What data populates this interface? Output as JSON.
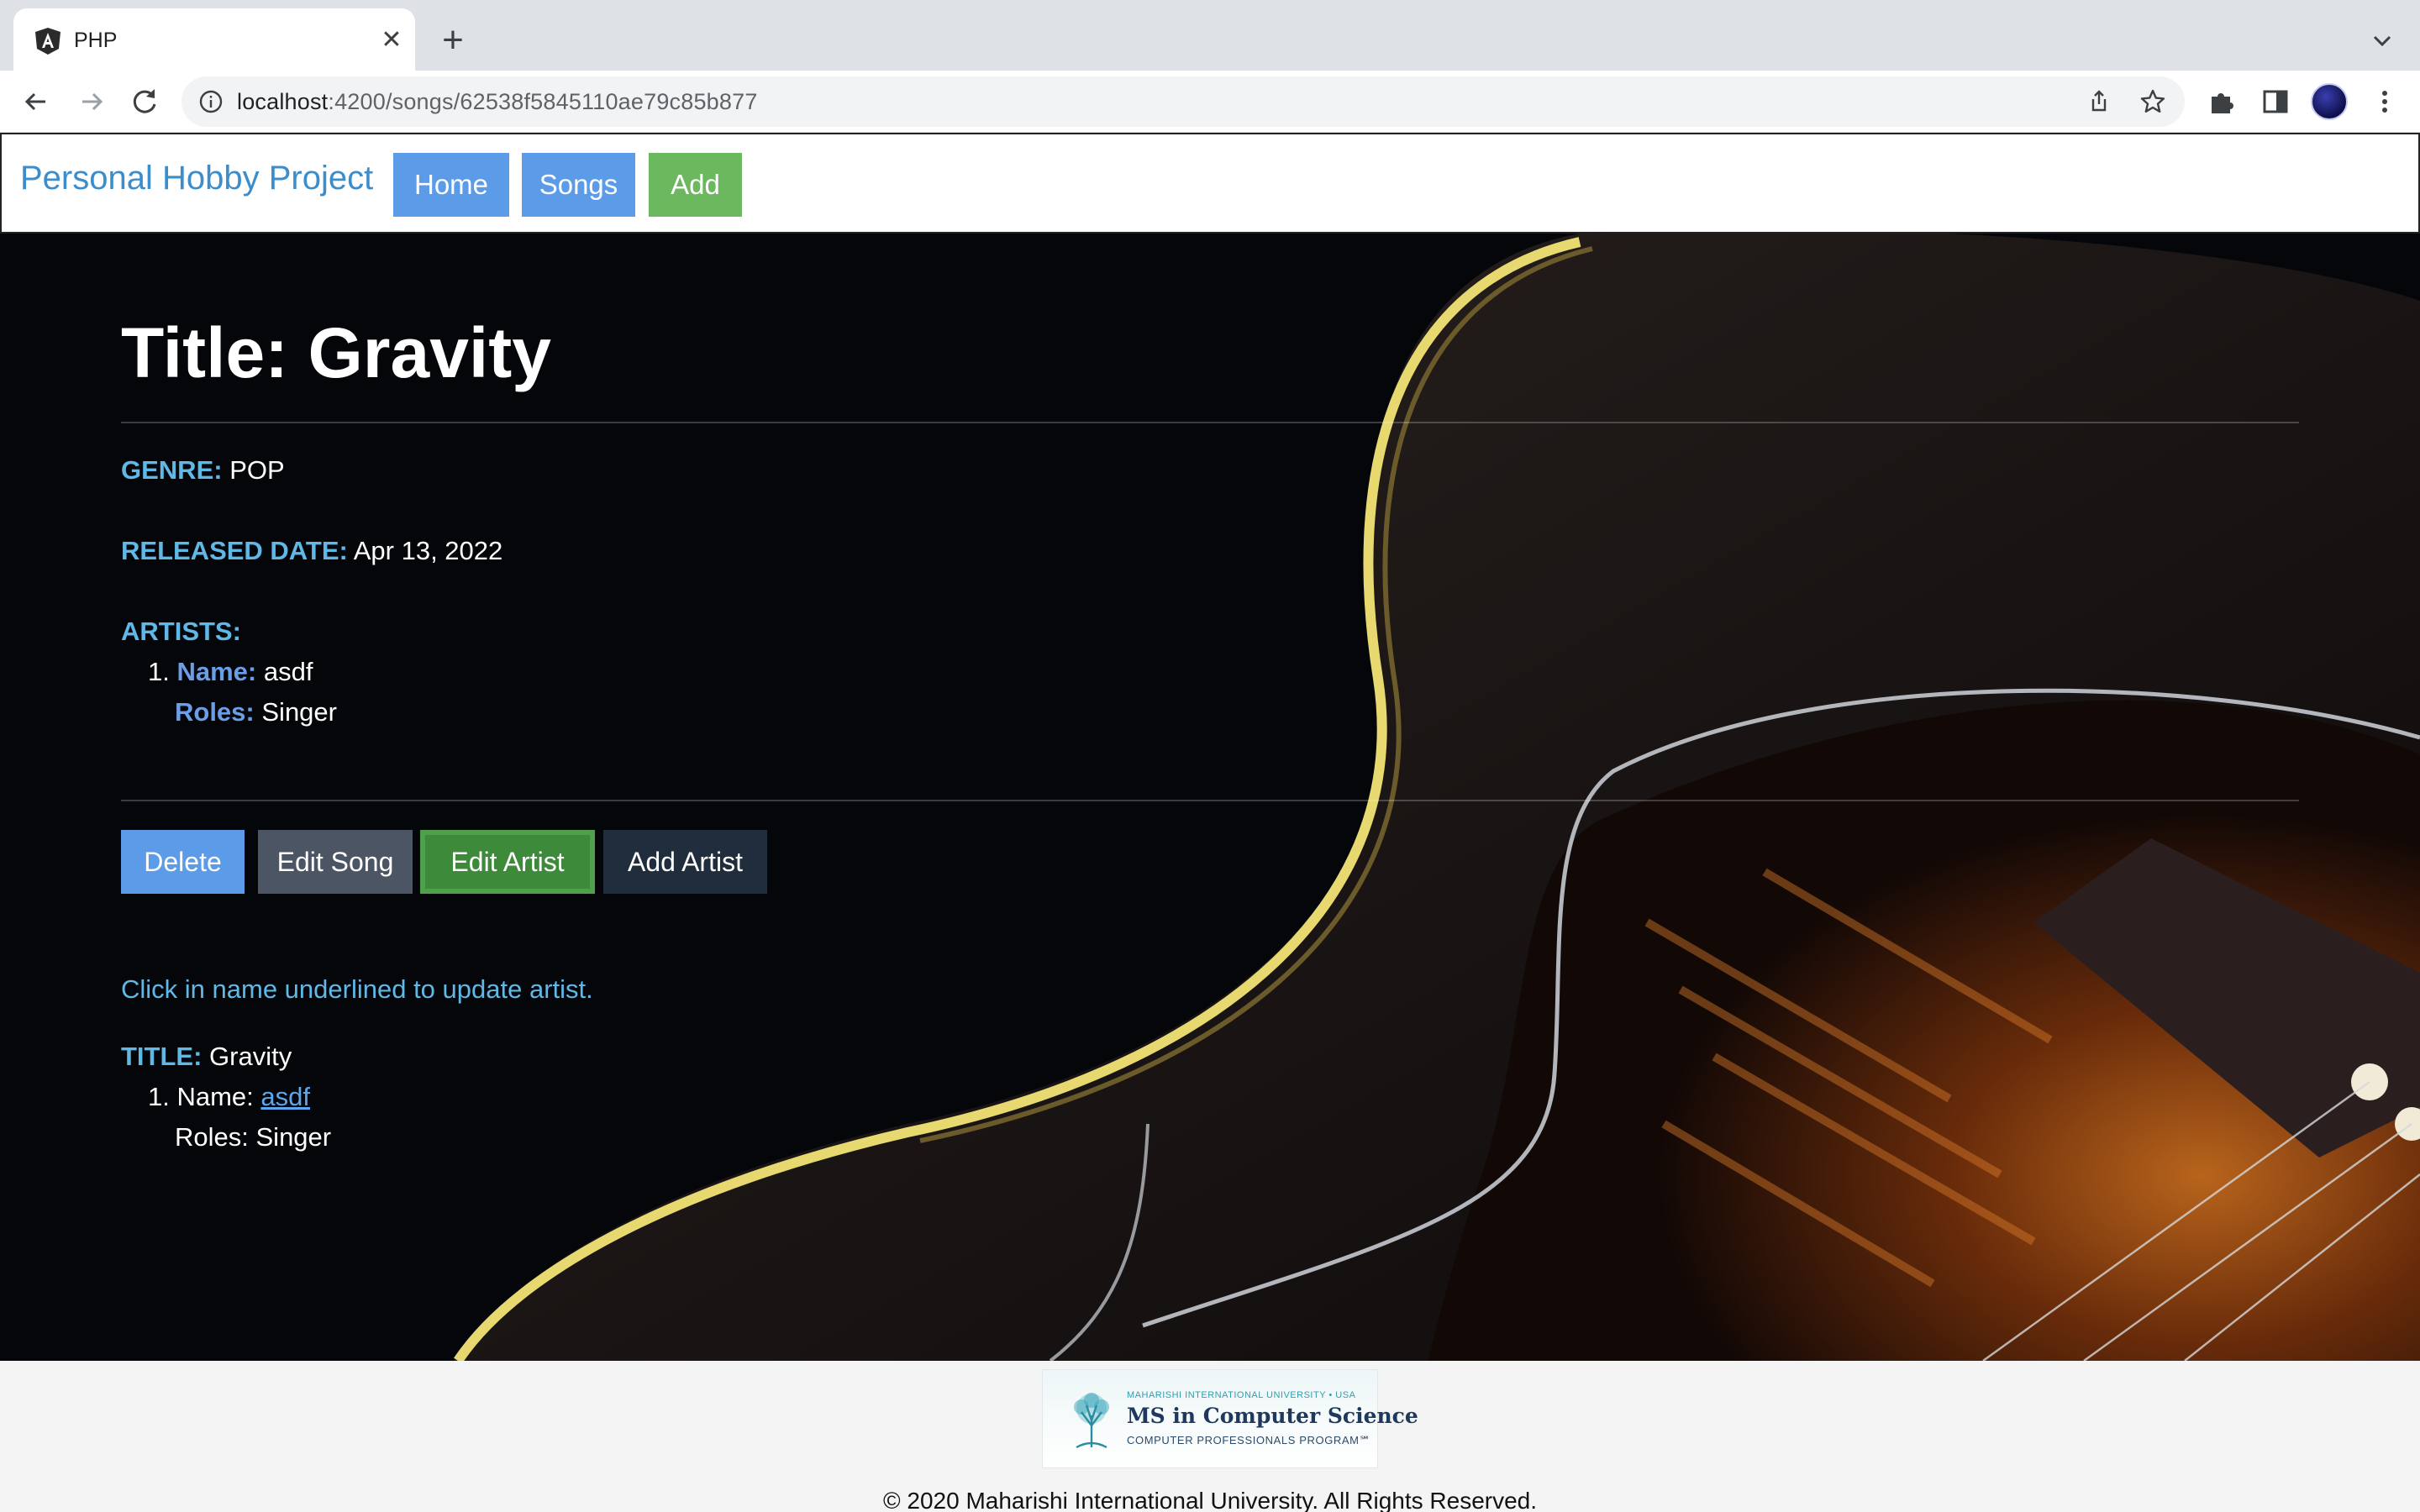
{
  "browser": {
    "tab_title": "PHP",
    "url_host": "localhost",
    "url_path": ":4200/songs/62538f5845110ae79c85b877"
  },
  "navbar": {
    "brand": "Personal Hobby Project",
    "links": [
      {
        "label": "Home",
        "color": "#5b9be8"
      },
      {
        "label": "Songs",
        "color": "#5b9be8"
      },
      {
        "label": "Add",
        "color": "#6bb85f"
      }
    ]
  },
  "song": {
    "title_label": "Title: Gravity",
    "genre_label": "GENRE:",
    "genre": "POP",
    "released_label": "RELEASED DATE:",
    "released": "Apr 13, 2022",
    "artists_label": "ARTISTS:",
    "artists": [
      {
        "number": "1.",
        "name_label": "Name:",
        "name": "asdf",
        "roles_label": "Roles:",
        "roles": "Singer"
      }
    ]
  },
  "actions": {
    "delete": "Delete",
    "edit_song": "Edit Song",
    "edit_artist": "Edit Artist",
    "add_artist": "Add Artist"
  },
  "edit_panel": {
    "hint": "Click in name underlined to update artist.",
    "title_label": "TITLE:",
    "title": "Gravity",
    "artists": [
      {
        "number": "1.",
        "name_label": "Name:",
        "name": "asdf",
        "roles_label": "Roles:",
        "roles": "Singer"
      }
    ]
  },
  "footer": {
    "logo_line1": "MAHARISHI INTERNATIONAL UNIVERSITY • USA",
    "logo_line2": "MS in Computer Science",
    "logo_line3": "COMPUTER PROFESSIONALS PROGRAM℠",
    "copyright": "© 2020 Maharishi International University. All Rights Reserved."
  },
  "colors": {
    "accent_blue": "#5b9be8",
    "accent_green": "#6bb85f",
    "label_cyan": "#5fb8e6",
    "slate_button": "#4b5563",
    "dark_button": "#1f2d3d"
  }
}
